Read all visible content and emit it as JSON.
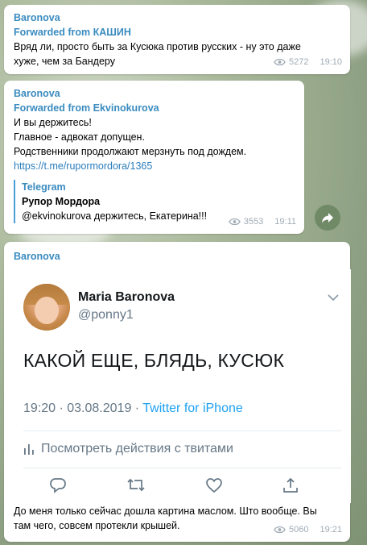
{
  "messages": [
    {
      "author": "Baronova",
      "forwarded": "Forwarded from КАШИН",
      "lines": [
        "Вряд ли, просто быть за Кусюка против русских - ну это даже",
        "хуже, чем за Бандеру"
      ],
      "views": "5272",
      "time": "19:10"
    },
    {
      "author": "Baronova",
      "forwarded": "Forwarded from Ekvinokurova",
      "lines": [
        "И вы держитесь!",
        "Главное - адвокат допущен.",
        "Родственники продолжают мерзнуть под дождем."
      ],
      "link": "https://t.me/rupormordora/1365",
      "preview": {
        "source": "Telegram",
        "title": "Рупор Мордора",
        "text": "@ekvinokurova держитесь, Екатерина!!!"
      },
      "views": "3553",
      "time": "19:11"
    },
    {
      "author": "Baronova",
      "tweet": {
        "name": "Maria Baronova",
        "handle": "@ponny1",
        "text": "КАКОЙ ЕЩЕ, БЛЯДЬ, КУСЮК",
        "date": "19:20 · 03.08.2019 · ",
        "source": "Twitter for iPhone",
        "activity": "Посмотреть действия с твитами"
      },
      "lines": [
        "До меня только сейчас дошла картина маслом. Што вообще. Вы",
        "там чего, совсем протекли крышей."
      ],
      "views": "5060",
      "time": "19:21"
    }
  ],
  "colors": {
    "accent": "#3a8bbf",
    "link": "#2a7dbc",
    "twitter_blue": "#1da1f2",
    "share_button": "#708a67"
  },
  "icons": [
    "eye-icon",
    "share-icon",
    "chevron-down-icon",
    "bar-chart-icon",
    "reply-icon",
    "retweet-icon",
    "like-icon",
    "upload-icon"
  ]
}
